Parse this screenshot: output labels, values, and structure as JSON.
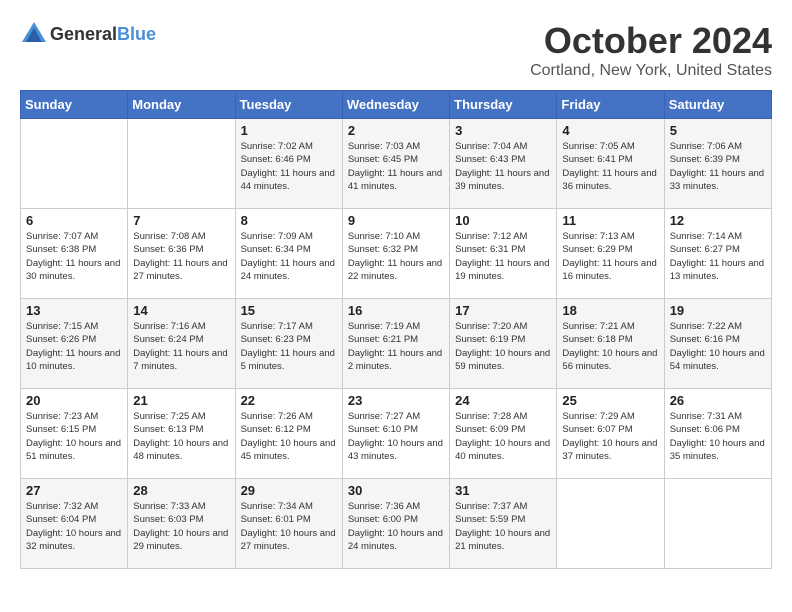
{
  "header": {
    "logo_general": "General",
    "logo_blue": "Blue",
    "month": "October 2024",
    "location": "Cortland, New York, United States"
  },
  "weekdays": [
    "Sunday",
    "Monday",
    "Tuesday",
    "Wednesday",
    "Thursday",
    "Friday",
    "Saturday"
  ],
  "weeks": [
    [
      {
        "day": "",
        "sunrise": "",
        "sunset": "",
        "daylight": ""
      },
      {
        "day": "",
        "sunrise": "",
        "sunset": "",
        "daylight": ""
      },
      {
        "day": "1",
        "sunrise": "Sunrise: 7:02 AM",
        "sunset": "Sunset: 6:46 PM",
        "daylight": "Daylight: 11 hours and 44 minutes."
      },
      {
        "day": "2",
        "sunrise": "Sunrise: 7:03 AM",
        "sunset": "Sunset: 6:45 PM",
        "daylight": "Daylight: 11 hours and 41 minutes."
      },
      {
        "day": "3",
        "sunrise": "Sunrise: 7:04 AM",
        "sunset": "Sunset: 6:43 PM",
        "daylight": "Daylight: 11 hours and 39 minutes."
      },
      {
        "day": "4",
        "sunrise": "Sunrise: 7:05 AM",
        "sunset": "Sunset: 6:41 PM",
        "daylight": "Daylight: 11 hours and 36 minutes."
      },
      {
        "day": "5",
        "sunrise": "Sunrise: 7:06 AM",
        "sunset": "Sunset: 6:39 PM",
        "daylight": "Daylight: 11 hours and 33 minutes."
      }
    ],
    [
      {
        "day": "6",
        "sunrise": "Sunrise: 7:07 AM",
        "sunset": "Sunset: 6:38 PM",
        "daylight": "Daylight: 11 hours and 30 minutes."
      },
      {
        "day": "7",
        "sunrise": "Sunrise: 7:08 AM",
        "sunset": "Sunset: 6:36 PM",
        "daylight": "Daylight: 11 hours and 27 minutes."
      },
      {
        "day": "8",
        "sunrise": "Sunrise: 7:09 AM",
        "sunset": "Sunset: 6:34 PM",
        "daylight": "Daylight: 11 hours and 24 minutes."
      },
      {
        "day": "9",
        "sunrise": "Sunrise: 7:10 AM",
        "sunset": "Sunset: 6:32 PM",
        "daylight": "Daylight: 11 hours and 22 minutes."
      },
      {
        "day": "10",
        "sunrise": "Sunrise: 7:12 AM",
        "sunset": "Sunset: 6:31 PM",
        "daylight": "Daylight: 11 hours and 19 minutes."
      },
      {
        "day": "11",
        "sunrise": "Sunrise: 7:13 AM",
        "sunset": "Sunset: 6:29 PM",
        "daylight": "Daylight: 11 hours and 16 minutes."
      },
      {
        "day": "12",
        "sunrise": "Sunrise: 7:14 AM",
        "sunset": "Sunset: 6:27 PM",
        "daylight": "Daylight: 11 hours and 13 minutes."
      }
    ],
    [
      {
        "day": "13",
        "sunrise": "Sunrise: 7:15 AM",
        "sunset": "Sunset: 6:26 PM",
        "daylight": "Daylight: 11 hours and 10 minutes."
      },
      {
        "day": "14",
        "sunrise": "Sunrise: 7:16 AM",
        "sunset": "Sunset: 6:24 PM",
        "daylight": "Daylight: 11 hours and 7 minutes."
      },
      {
        "day": "15",
        "sunrise": "Sunrise: 7:17 AM",
        "sunset": "Sunset: 6:23 PM",
        "daylight": "Daylight: 11 hours and 5 minutes."
      },
      {
        "day": "16",
        "sunrise": "Sunrise: 7:19 AM",
        "sunset": "Sunset: 6:21 PM",
        "daylight": "Daylight: 11 hours and 2 minutes."
      },
      {
        "day": "17",
        "sunrise": "Sunrise: 7:20 AM",
        "sunset": "Sunset: 6:19 PM",
        "daylight": "Daylight: 10 hours and 59 minutes."
      },
      {
        "day": "18",
        "sunrise": "Sunrise: 7:21 AM",
        "sunset": "Sunset: 6:18 PM",
        "daylight": "Daylight: 10 hours and 56 minutes."
      },
      {
        "day": "19",
        "sunrise": "Sunrise: 7:22 AM",
        "sunset": "Sunset: 6:16 PM",
        "daylight": "Daylight: 10 hours and 54 minutes."
      }
    ],
    [
      {
        "day": "20",
        "sunrise": "Sunrise: 7:23 AM",
        "sunset": "Sunset: 6:15 PM",
        "daylight": "Daylight: 10 hours and 51 minutes."
      },
      {
        "day": "21",
        "sunrise": "Sunrise: 7:25 AM",
        "sunset": "Sunset: 6:13 PM",
        "daylight": "Daylight: 10 hours and 48 minutes."
      },
      {
        "day": "22",
        "sunrise": "Sunrise: 7:26 AM",
        "sunset": "Sunset: 6:12 PM",
        "daylight": "Daylight: 10 hours and 45 minutes."
      },
      {
        "day": "23",
        "sunrise": "Sunrise: 7:27 AM",
        "sunset": "Sunset: 6:10 PM",
        "daylight": "Daylight: 10 hours and 43 minutes."
      },
      {
        "day": "24",
        "sunrise": "Sunrise: 7:28 AM",
        "sunset": "Sunset: 6:09 PM",
        "daylight": "Daylight: 10 hours and 40 minutes."
      },
      {
        "day": "25",
        "sunrise": "Sunrise: 7:29 AM",
        "sunset": "Sunset: 6:07 PM",
        "daylight": "Daylight: 10 hours and 37 minutes."
      },
      {
        "day": "26",
        "sunrise": "Sunrise: 7:31 AM",
        "sunset": "Sunset: 6:06 PM",
        "daylight": "Daylight: 10 hours and 35 minutes."
      }
    ],
    [
      {
        "day": "27",
        "sunrise": "Sunrise: 7:32 AM",
        "sunset": "Sunset: 6:04 PM",
        "daylight": "Daylight: 10 hours and 32 minutes."
      },
      {
        "day": "28",
        "sunrise": "Sunrise: 7:33 AM",
        "sunset": "Sunset: 6:03 PM",
        "daylight": "Daylight: 10 hours and 29 minutes."
      },
      {
        "day": "29",
        "sunrise": "Sunrise: 7:34 AM",
        "sunset": "Sunset: 6:01 PM",
        "daylight": "Daylight: 10 hours and 27 minutes."
      },
      {
        "day": "30",
        "sunrise": "Sunrise: 7:36 AM",
        "sunset": "Sunset: 6:00 PM",
        "daylight": "Daylight: 10 hours and 24 minutes."
      },
      {
        "day": "31",
        "sunrise": "Sunrise: 7:37 AM",
        "sunset": "Sunset: 5:59 PM",
        "daylight": "Daylight: 10 hours and 21 minutes."
      },
      {
        "day": "",
        "sunrise": "",
        "sunset": "",
        "daylight": ""
      },
      {
        "day": "",
        "sunrise": "",
        "sunset": "",
        "daylight": ""
      }
    ]
  ]
}
